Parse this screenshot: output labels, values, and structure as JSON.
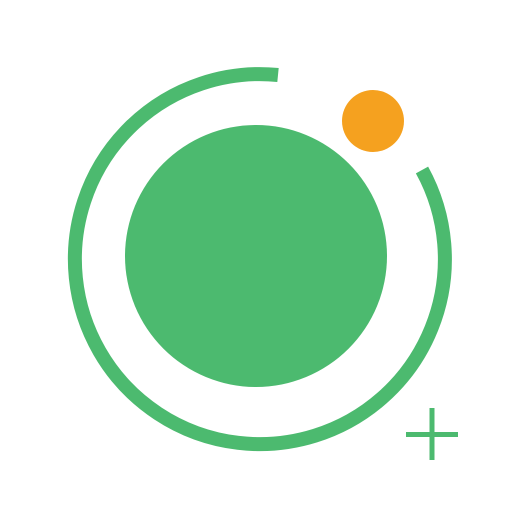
{
  "app_icon": {
    "icon": "orbit-logo-with-plus",
    "colors": {
      "background": "#ffffff",
      "primary_green": "#4cba6f",
      "accent_orange": "#f5a11f"
    },
    "badge": {
      "icon": "plus-icon",
      "color": "#4cba6f"
    }
  }
}
